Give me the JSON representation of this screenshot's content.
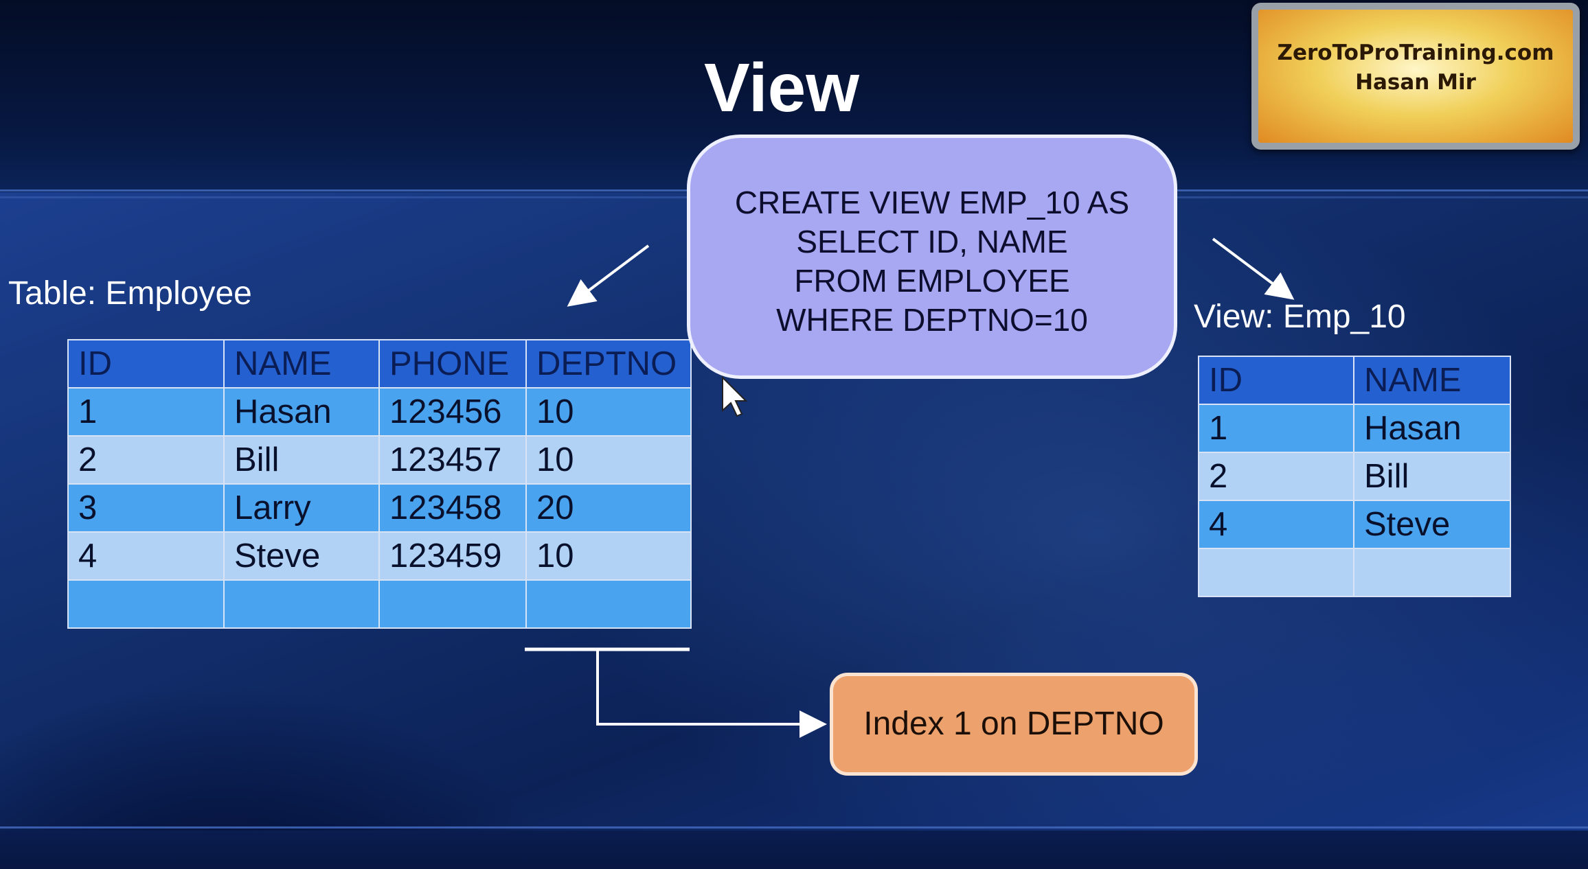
{
  "slide": {
    "title": "View",
    "badge": {
      "line1": "ZeroToProTraining.com",
      "line2": "Hasan Mir"
    }
  },
  "sql": {
    "lines": [
      "CREATE VIEW EMP_10 AS",
      "SELECT ID, NAME",
      "FROM EMPLOYEE",
      "WHERE DEPTNO=10"
    ]
  },
  "employee_table": {
    "caption": "Table: Employee",
    "headers": [
      "ID",
      "NAME",
      "PHONE",
      "DEPTNO"
    ],
    "rows": [
      [
        "1",
        "Hasan",
        "123456",
        "10"
      ],
      [
        "2",
        "Bill",
        "123457",
        "10"
      ],
      [
        "3",
        "Larry",
        "123458",
        "20"
      ],
      [
        "4",
        "Steve",
        "123459",
        "10"
      ],
      [
        "",
        "",
        "",
        ""
      ]
    ]
  },
  "view_table": {
    "caption": "View: Emp_10",
    "headers": [
      "ID",
      "NAME"
    ],
    "rows": [
      [
        "1",
        "Hasan"
      ],
      [
        "2",
        "Bill"
      ],
      [
        "4",
        "Steve"
      ],
      [
        "",
        ""
      ]
    ]
  },
  "index": {
    "label": "Index 1 on DEPTNO"
  },
  "colors": {
    "sql_bubble": "#a7a7f2",
    "index_box": "#eda26e",
    "table_header": "#2560d0",
    "row_dark": "#4aa3ef",
    "row_light": "#b1d2f4"
  }
}
